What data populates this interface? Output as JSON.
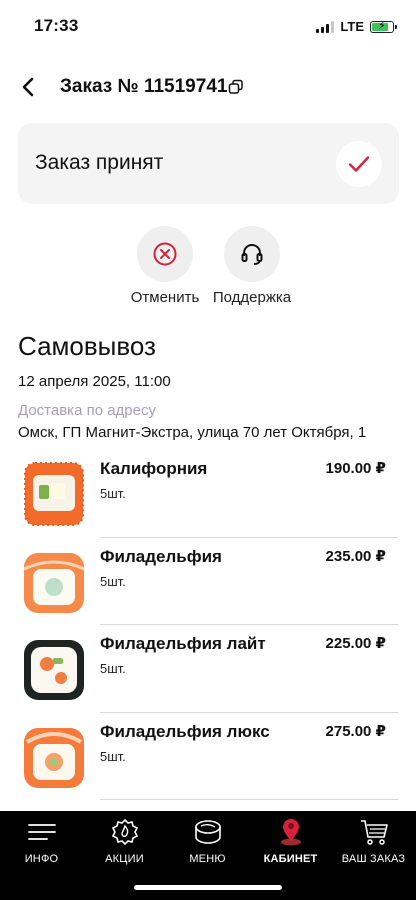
{
  "status_bar": {
    "time": "17:33",
    "network": "LTE",
    "battery_level": 0.8,
    "battery_color": "#3cc35a"
  },
  "header": {
    "title": "Заказ № 11519741",
    "back_icon": "chevron-left-icon",
    "copy_icon": "copy-icon"
  },
  "order_status": {
    "text": "Заказ принят",
    "icon": "checkmark-icon",
    "accent": "#d6213a"
  },
  "actions": [
    {
      "label": "Отменить",
      "icon": "cancel-circle-icon",
      "color": "#d6213a"
    },
    {
      "label": "Поддержка",
      "icon": "headset-icon",
      "color": "#111111"
    }
  ],
  "order": {
    "delivery_type": "Самовывоз",
    "date": "12 апреля 2025, 11:00",
    "address_label": "Доставка по адресу",
    "address": "Омск, ГП Магнит-Экстра, улица 70 лет Октября, 1"
  },
  "items": [
    {
      "name": "Калифорния",
      "qty": "5шт.",
      "price": "190.00 ₽",
      "image": "california-roll-image"
    },
    {
      "name": "Филадельфия",
      "qty": "5шт.",
      "price": "235.00 ₽",
      "image": "philadelphia-roll-image"
    },
    {
      "name": "Филадельфия лайт",
      "qty": "5шт.",
      "price": "225.00 ₽",
      "image": "philadelphia-light-roll-image"
    },
    {
      "name": "Филадельфия люкс",
      "qty": "5шт.",
      "price": "275.00 ₽",
      "image": "philadelphia-lux-roll-image"
    }
  ],
  "tab_bar": {
    "active_color": "#d6213a",
    "tabs": [
      {
        "label": "ИНФО",
        "icon": "menu-lines-icon",
        "active": false
      },
      {
        "label": "АКЦИИ",
        "icon": "fire-badge-icon",
        "active": false
      },
      {
        "label": "МЕНЮ",
        "icon": "sushi-icon",
        "active": false
      },
      {
        "label": "КАБИНЕТ",
        "icon": "user-pin-icon",
        "active": true
      },
      {
        "label": "ВАШ ЗАКАЗ",
        "icon": "cart-icon",
        "active": false
      }
    ]
  }
}
